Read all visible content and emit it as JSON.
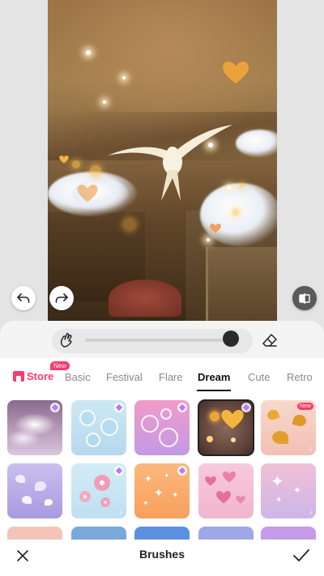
{
  "toolbar": {
    "undo_icon": "undo-icon",
    "redo_icon": "redo-icon",
    "compare_icon": "compare-icon"
  },
  "brush_controls": {
    "brush_icon": "hand-brush-icon",
    "eraser_icon": "eraser-icon",
    "size_value": 0.95
  },
  "tabs": {
    "store_label": "Store",
    "store_badge": "New",
    "items": [
      {
        "label": "Basic",
        "active": false
      },
      {
        "label": "Festival",
        "active": false
      },
      {
        "label": "Flare",
        "active": false
      },
      {
        "label": "Dream",
        "active": true
      },
      {
        "label": "Cute",
        "active": false
      },
      {
        "label": "Retro",
        "active": false
      }
    ]
  },
  "brush_tiles": {
    "new_badge": "New",
    "names": [
      "purple-clouds",
      "bubbles-blue",
      "bubbles-pink",
      "golden-hearts",
      "golden-butterflies",
      "butterflies-lilac",
      "cherry-blossoms",
      "stars-orange",
      "pink-hearts",
      "sparkle-stars"
    ],
    "selected": "golden-hearts"
  },
  "footer": {
    "title": "Brushes",
    "cancel_icon": "close-icon",
    "confirm_icon": "checkmark-icon"
  },
  "colors": {
    "accent": "#ff3a6a",
    "panel": "#ffffff",
    "background": "#e4e4e4"
  }
}
